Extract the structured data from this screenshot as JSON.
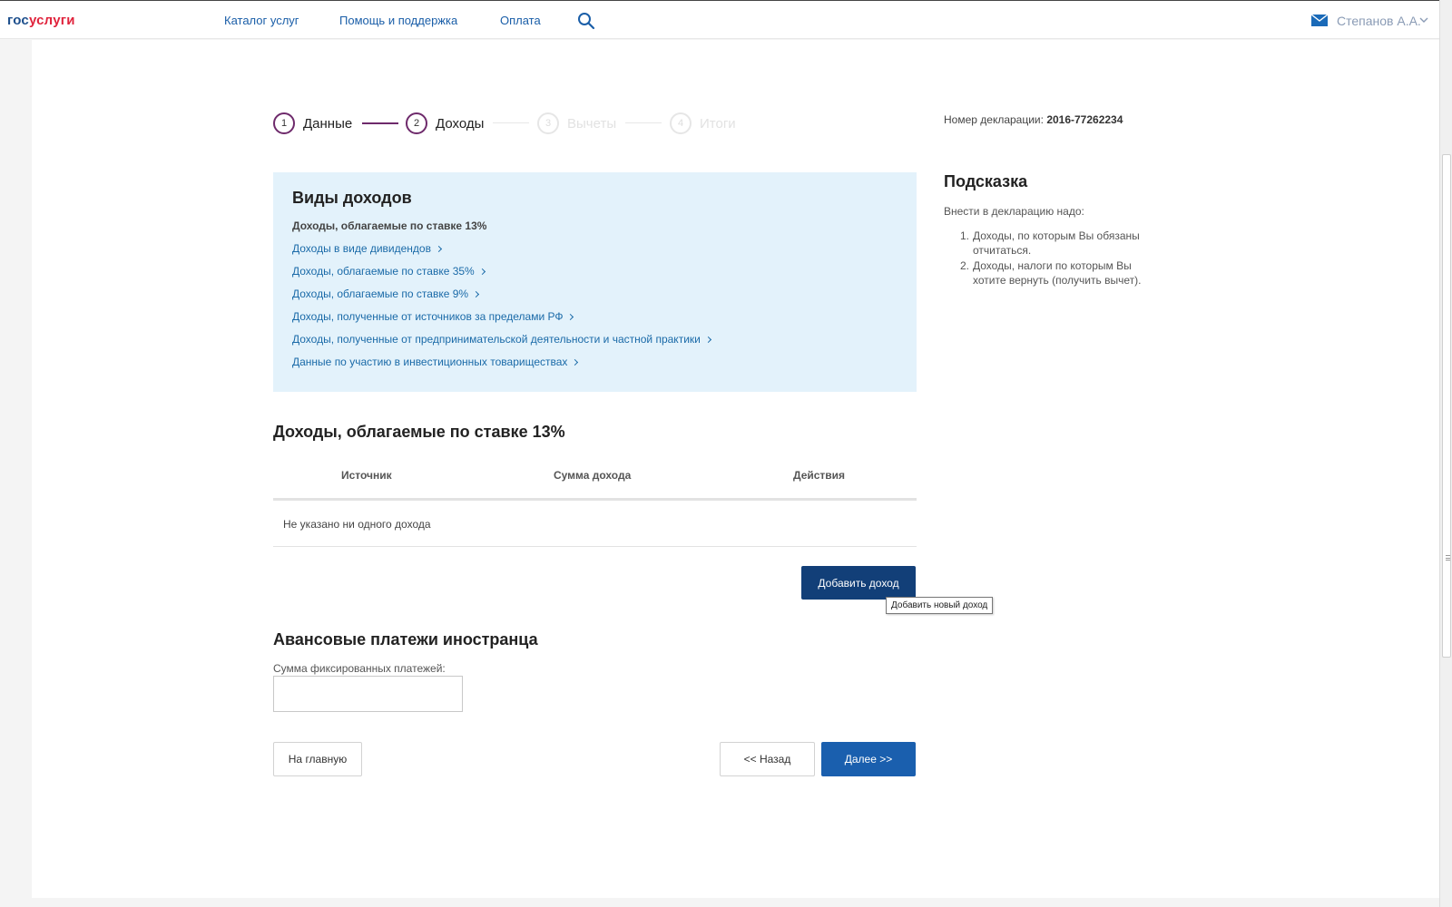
{
  "header": {
    "logo": {
      "gos": "гос",
      "uslugi": "услуги"
    },
    "nav": [
      "Каталог услуг",
      "Помощь и поддержка",
      "Оплата"
    ],
    "user": "Степанов А.А."
  },
  "stepper": [
    {
      "num": "1",
      "label": "Данные",
      "state": "done"
    },
    {
      "num": "2",
      "label": "Доходы",
      "state": "active"
    },
    {
      "num": "3",
      "label": "Вычеты",
      "state": "inactive"
    },
    {
      "num": "4",
      "label": "Итоги",
      "state": "inactive"
    }
  ],
  "declaration": {
    "label": "Номер декларации:",
    "number": "2016-77262234"
  },
  "income_types": {
    "title": "Виды доходов",
    "active": "Доходы, облагаемые по ставке 13%",
    "links": [
      "Доходы в виде дивидендов",
      "Доходы, облагаемые по ставке 35%",
      "Доходы, облагаемые по ставке 9%",
      "Доходы, полученные от источников за пределами РФ",
      "Доходы, полученные от предпринимательской деятельности и частной практики",
      "Данные по участию в инвестиционных товариществах"
    ]
  },
  "income_table": {
    "title": "Доходы, облагаемые по ставке 13%",
    "columns": [
      "Источник",
      "Сумма дохода",
      "Действия"
    ],
    "empty": "Не указано ни одного дохода",
    "add_button": "Добавить доход",
    "add_tooltip": "Добавить новый доход"
  },
  "advance": {
    "title": "Авансовые платежи иностранца",
    "field_label": "Сумма фиксированных платежей:",
    "field_value": ""
  },
  "footer_buttons": {
    "home": "На главную",
    "back": "<< Назад",
    "next": "Далее >>"
  },
  "hint": {
    "title": "Подсказка",
    "intro": "Внести в декларацию надо:",
    "items": [
      "Доходы, по которым Вы обязаны отчитаться.",
      "Доходы, налоги по которым Вы хотите вернуть (получить вычет)."
    ]
  },
  "colors": {
    "brand_blue": "#1d4f8c",
    "brand_red": "#e0233c",
    "step_accent": "#6e2a6b",
    "panel_bg": "#e3f2fb",
    "primary": "#1a5fae",
    "primary_dark": "#123f78"
  }
}
